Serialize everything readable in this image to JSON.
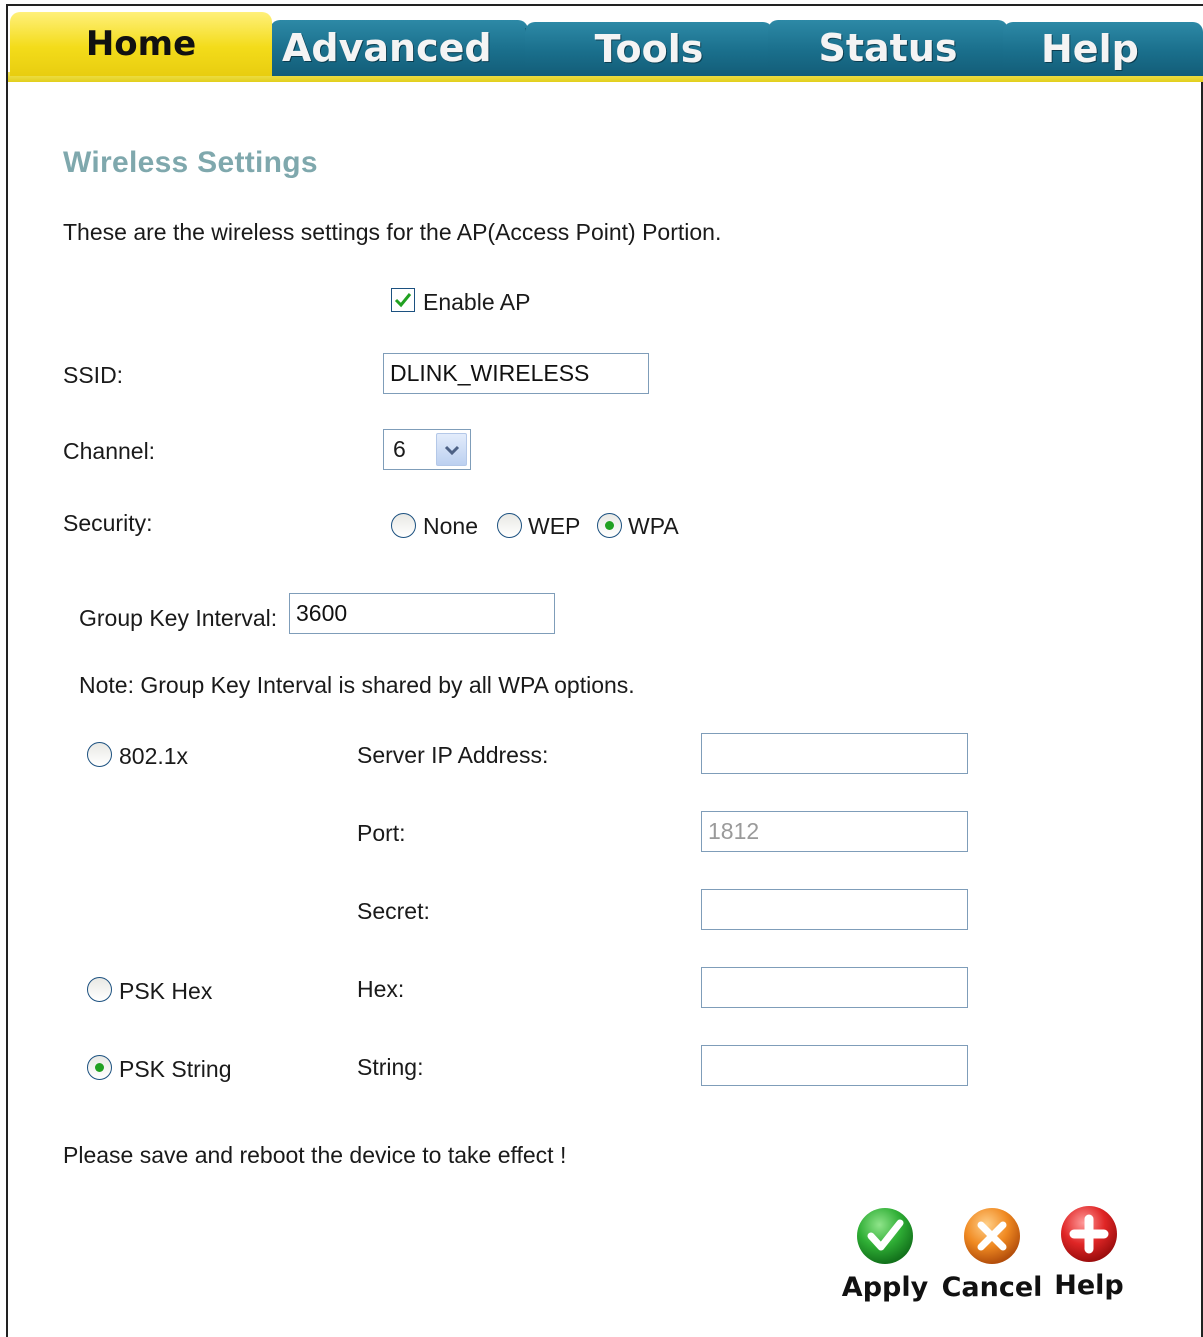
{
  "tabs": {
    "home": "Home",
    "advanced": "Advanced",
    "tools": "Tools",
    "status": "Status",
    "help": "Help"
  },
  "page": {
    "title": "Wireless Settings",
    "description": "These are the wireless settings for the AP(Access Point) Portion."
  },
  "form": {
    "enable_ap_label": "Enable AP",
    "enable_ap_checked": true,
    "ssid_label": "SSID:",
    "ssid_value": "DLINK_WIRELESS",
    "channel_label": "Channel:",
    "channel_value": "6",
    "security_label": "Security:",
    "security_options": [
      "None",
      "WEP",
      "WPA"
    ],
    "security_selected": "WPA",
    "group_key_label": "Group Key Interval:",
    "group_key_value": "3600",
    "note": "Note: Group Key Interval is shared by all WPA options.",
    "wpa_modes": {
      "radius": "802.1x",
      "psk_hex": "PSK Hex",
      "psk_string": "PSK String",
      "selected": "PSK String"
    },
    "server_ip_label": "Server IP Address:",
    "server_ip_value": "",
    "port_label": "Port:",
    "port_value": "1812",
    "secret_label": "Secret:",
    "secret_value": "",
    "hex_label": "Hex:",
    "hex_value": "",
    "string_label": "String:",
    "string_value": ""
  },
  "footer": {
    "reboot_note": "Please save and reboot the device to take effect !",
    "apply": "Apply",
    "cancel": "Cancel",
    "help": "Help"
  },
  "colors": {
    "title": "#7fa8ad",
    "tab_blue": "#1a6f8c",
    "tab_yellow": "#f3dc1a",
    "apply_green": "#1f9b2a",
    "cancel_orange": "#e8781c",
    "help_red": "#d51c1c"
  },
  "icons": {
    "apply": "check-icon",
    "cancel": "x-icon",
    "help": "plus-icon",
    "checkbox": "checkmark-icon",
    "select": "chevron-down-icon"
  }
}
